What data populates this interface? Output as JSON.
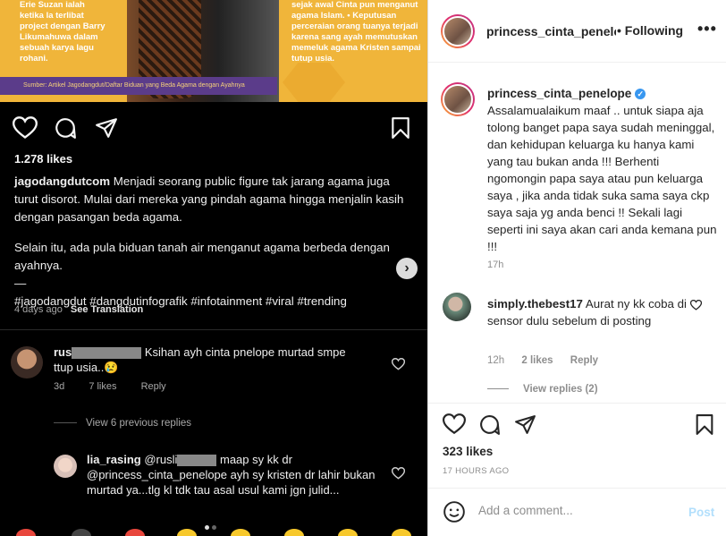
{
  "post_image": {
    "left_text": "Erie Suzan ialah ketika la terlibat project dengan Barry Likumahuwa dalam sebuah karya lagu rohani.",
    "right_text": "sejak awal Cinta pun menganut agama Islam. • Keputusan perceraian orang tuanya terjadi karena sang ayah memutuskan memeluk agama Kristen sampai tutup usia.",
    "source": "Sumber: Artikel Jagodangdut/Daftar Biduan yang Beda Agama dengan Ayahnya",
    "brand_color": "#f0b53a"
  },
  "left": {
    "likes": "1.278 likes",
    "caption_user": "jagodangdutcom",
    "caption_p1": " Menjadi seorang public figure tak jarang agama juga turut disorot. Mulai dari mereka yang pindah agama hingga menjalin kasih dengan pasangan beda agama.",
    "caption_p2": "Selain itu, ada pula biduan tanah air menganut agama berbeda dengan ayahnya.",
    "caption_dash": "—",
    "caption_tags": "#jagodangdut #dangdutinfografik #infotainment #viral #trending",
    "time": "4 days ago",
    "see_translation": "See Translation",
    "comment1": {
      "user": "rus",
      "text": "Ksihan ayh cinta pnelope murtad smpe ttup usia..😢",
      "age": "3d",
      "likes": "7 likes",
      "reply": "Reply"
    },
    "view_replies": "View 6 previous replies",
    "comment2": {
      "user": "lia_rasing",
      "mention1": "@rusli",
      "text1": " maap sy kk dr",
      "mention2": "@princess_cinta_penelope",
      "text2": " ayh sy kristen dr lahir bukan murtad ya...tlg kl tdk tau asal usul kami jgn julid..."
    }
  },
  "right": {
    "header_user": "princess_cinta_penelope",
    "header_follow": "• Following",
    "more": "•••",
    "caption_user": "princess_cinta_penelope",
    "caption_text": "Assalamualaikum maaf .. untuk siapa aja tolong banget papa saya sudah meninggal, dan kehidupan keluarga ku hanya kami yang tau bukan anda !!! Berhenti ngomongin papa saya atau pun keluarga saya , jika anda tidak suka sama saya ckp saya saja yg anda benci !! Sekali lagi seperti ini saya akan cari anda kemana pun !!!",
    "caption_time": "17h",
    "comment": {
      "user": "simply.thebest17",
      "text": " Aurat ny kk coba di sensor dulu sebelum di posting",
      "age": "12h",
      "likes": "2 likes",
      "reply": "Reply",
      "view_replies": "View replies (2)"
    },
    "likes": "323 likes",
    "date": "17 HOURS AGO",
    "add_comment_placeholder": "Add a comment...",
    "post_label": "Post",
    "accent": "#3897f0"
  }
}
